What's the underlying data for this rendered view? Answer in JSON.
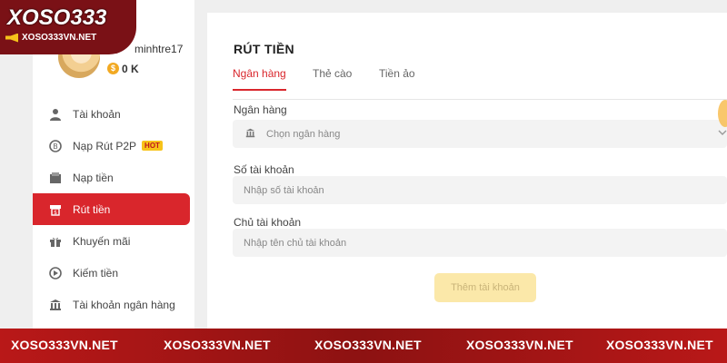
{
  "logo": {
    "main": "XOSO333",
    "sub": "XOSO333VN.NET"
  },
  "user": {
    "name": "minhtre17",
    "balance": "0 K",
    "coin": "$"
  },
  "sidebar": {
    "items": [
      {
        "label": "Tài khoản",
        "icon": "user-icon"
      },
      {
        "label": "Nạp Rút P2P",
        "icon": "p2p-coin-icon",
        "badge": "HOT"
      },
      {
        "label": "Nạp tiền",
        "icon": "deposit-icon"
      },
      {
        "label": "Rút tiền",
        "icon": "withdraw-icon",
        "active": true
      },
      {
        "label": "Khuyến mãi",
        "icon": "gift-icon"
      },
      {
        "label": "Kiếm tiền",
        "icon": "earn-icon"
      },
      {
        "label": "Tài khoản ngân hàng",
        "icon": "bank-icon"
      }
    ]
  },
  "main": {
    "title": "RÚT TIỀN",
    "tabs": [
      "Ngân hàng",
      "Thẻ cào",
      "Tiền ảo"
    ],
    "bank_label": "Ngân hàng",
    "bank_placeholder": "Chọn ngân hàng",
    "account_number_label": "Số tài khoản",
    "account_number_placeholder": "Nhập số tài khoản",
    "account_holder_label": "Chủ tài khoản",
    "account_holder_placeholder": "Nhập tên chủ tài khoản",
    "add_button": "Thêm tài khoản"
  },
  "footer": {
    "items": [
      "XOSO333VN.NET",
      "XOSO333VN.NET",
      "XOSO333VN.NET",
      "XOSO333VN.NET",
      "XOSO333VN.NET"
    ]
  },
  "colors": {
    "accent": "#d9262c",
    "button_disabled": "#fbe8a9",
    "footer": "#b91818"
  }
}
